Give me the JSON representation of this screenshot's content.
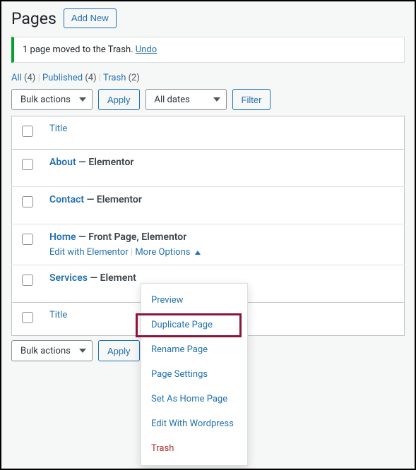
{
  "heading": "Pages",
  "add_new_label": "Add New",
  "notice": {
    "text": "1 page moved to the Trash. ",
    "undo": "Undo"
  },
  "filters": {
    "all": {
      "label": "All",
      "count": "(4)"
    },
    "published": {
      "label": "Published",
      "count": "(4)"
    },
    "trash": {
      "label": "Trash",
      "count": "(2)"
    }
  },
  "bulk_actions_label": "Bulk actions",
  "apply_label": "Apply",
  "all_dates_label": "All dates",
  "filter_btn_label": "Filter",
  "column_title": "Title",
  "rows": [
    {
      "title": "About",
      "meta": " — Elementor"
    },
    {
      "title": "Contact",
      "meta": " — Elementor"
    },
    {
      "title": "Home",
      "meta": " — Front Page, Elementor",
      "edit_elementor": "Edit with Elementor",
      "more_options": "More Options"
    },
    {
      "title": "Services",
      "meta": " — Element"
    }
  ],
  "dropdown": {
    "preview": "Preview",
    "duplicate": "Duplicate Page",
    "rename": "Rename Page",
    "settings": "Page Settings",
    "set_home": "Set As Home Page",
    "edit_wp": "Edit With Wordpress",
    "trash": "Trash"
  }
}
